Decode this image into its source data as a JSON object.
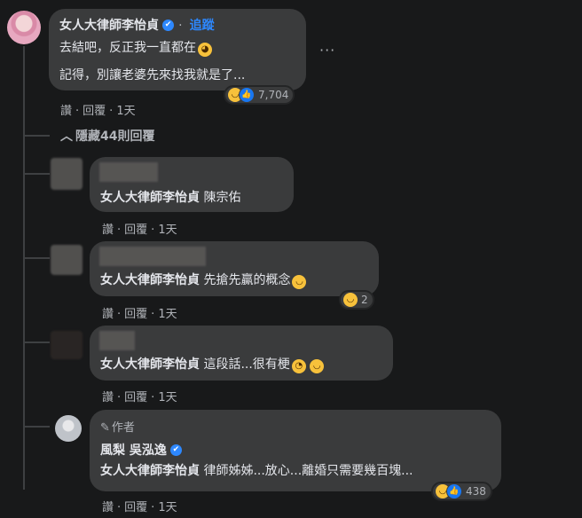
{
  "main_comment": {
    "author": "女人大律師李怡貞",
    "verified_icon": "✔",
    "separator": "·",
    "follow": "追蹤",
    "line1": "去結吧，反正我一直都在",
    "line2": "記得，別讓老婆先來找我就是了...",
    "reaction_count": "7,704",
    "actions": {
      "like": "讚",
      "dot1": "·",
      "reply": "回覆",
      "dot2": "·",
      "time": "1天"
    },
    "more": "···"
  },
  "hide_replies": {
    "icon": "chevron-up",
    "label": "隱藏44則回覆"
  },
  "replies": [
    {
      "mention": "女人大律師李怡貞",
      "text": "陳宗佑",
      "actions": {
        "like": "讚",
        "dot1": "·",
        "reply": "回覆",
        "dot2": "·",
        "time": "1天"
      }
    },
    {
      "mention": "女人大律師李怡貞",
      "text": "先搶先贏的概念",
      "reaction_count": "2",
      "actions": {
        "like": "讚",
        "dot1": "·",
        "reply": "回覆",
        "dot2": "·",
        "time": "1天"
      }
    },
    {
      "mention": "女人大律師李怡貞",
      "text": "這段話...很有梗",
      "actions": {
        "like": "讚",
        "dot1": "·",
        "reply": "回覆",
        "dot2": "·",
        "time": "1天"
      }
    },
    {
      "badge": "作者",
      "author": "風梨 吳泓逸",
      "mention": "女人大律師李怡貞",
      "text": "律師姊姊...放心...離婚只需要幾百塊...",
      "reaction_count": "438",
      "actions": {
        "like": "讚",
        "dot1": "·",
        "reply": "回覆",
        "dot2": "·",
        "time": "1天"
      }
    }
  ],
  "colors": {
    "background": "#18191a",
    "bubble": "#3a3b3c",
    "link": "#2d88ff",
    "muted": "#b0b3b8"
  }
}
